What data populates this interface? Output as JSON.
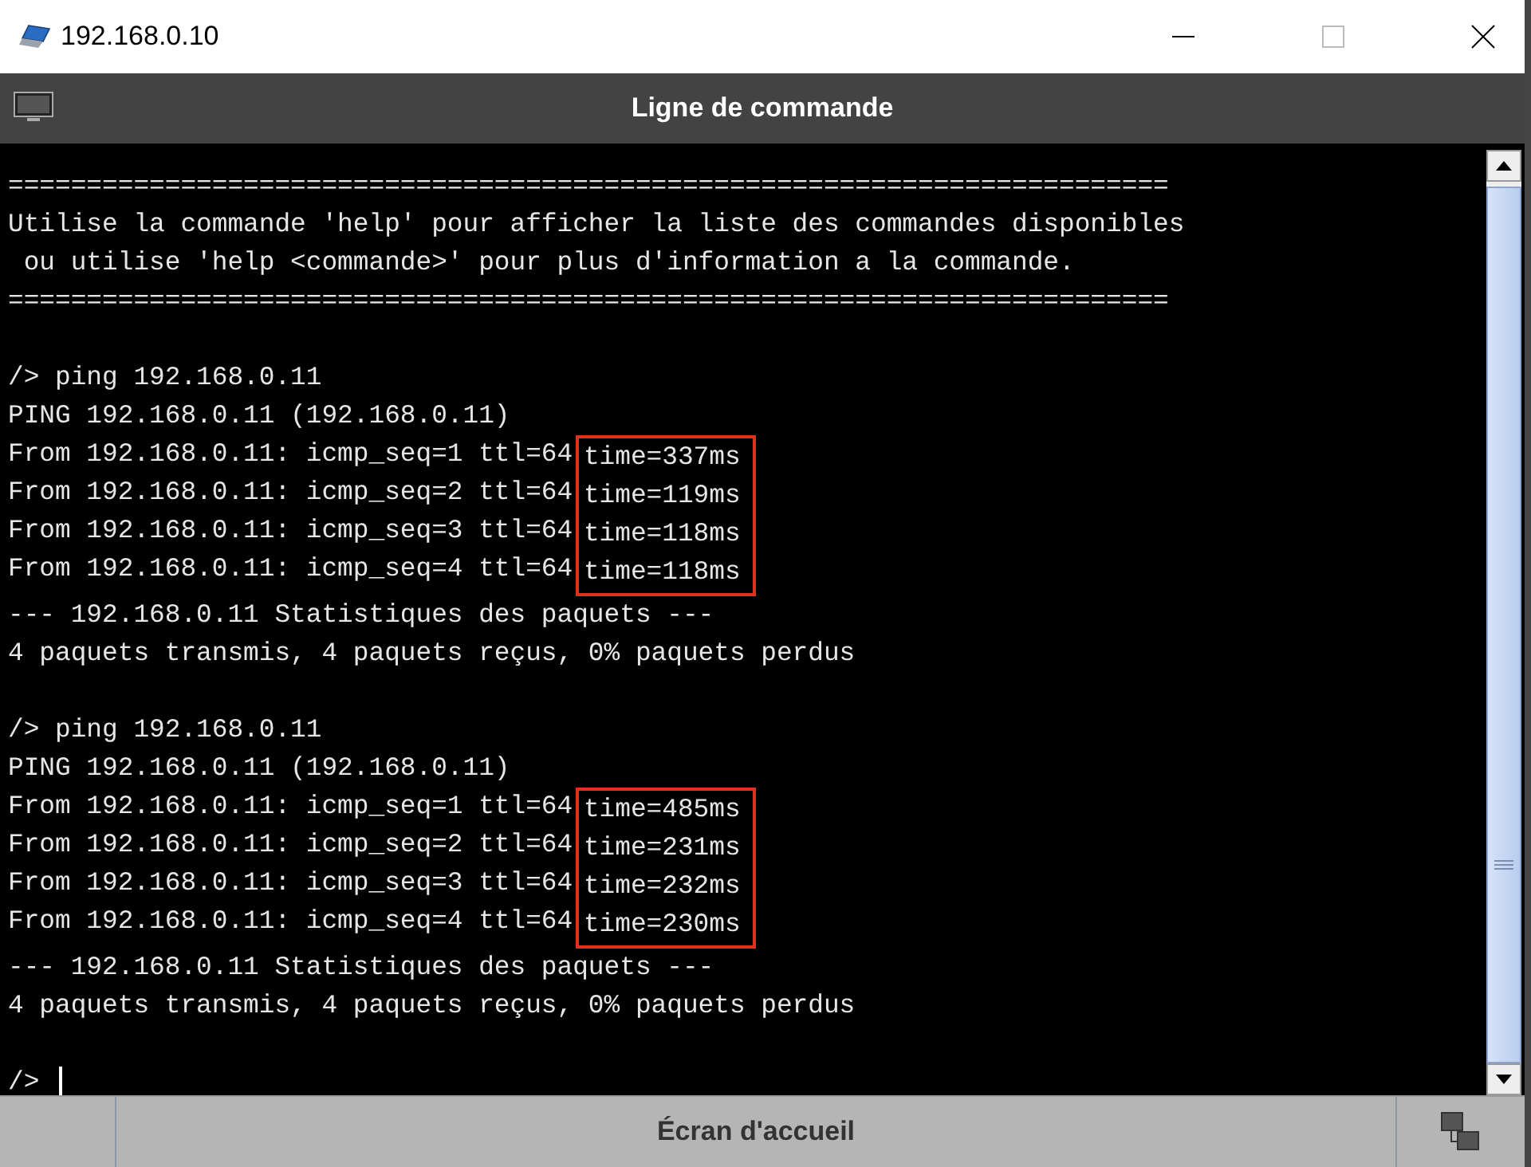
{
  "window": {
    "title": "192.168.0.10"
  },
  "header": {
    "title": "Ligne de commande"
  },
  "terminal": {
    "lines": [
      {
        "kind": "text",
        "text": "=========================================================================="
      },
      {
        "kind": "text",
        "text": "Utilise la commande 'help' pour afficher la liste des commandes disponibles"
      },
      {
        "kind": "text",
        "text": " ou utilise 'help <commande>' pour plus d'information a la commande."
      },
      {
        "kind": "text",
        "text": "=========================================================================="
      },
      {
        "kind": "blank"
      },
      {
        "kind": "text",
        "text": "/> ping 192.168.0.11"
      },
      {
        "kind": "text",
        "text": "PING 192.168.0.11 (192.168.0.11)"
      },
      {
        "kind": "replies",
        "items": [
          {
            "prefix": "From 192.168.0.11: icmp_seq=1 ttl=64",
            "time": "time=337ms"
          },
          {
            "prefix": "From 192.168.0.11: icmp_seq=2 ttl=64",
            "time": "time=119ms"
          },
          {
            "prefix": "From 192.168.0.11: icmp_seq=3 ttl=64",
            "time": "time=118ms"
          },
          {
            "prefix": "From 192.168.0.11: icmp_seq=4 ttl=64",
            "time": "time=118ms"
          }
        ]
      },
      {
        "kind": "text",
        "text": "--- 192.168.0.11 Statistiques des paquets ---"
      },
      {
        "kind": "text",
        "text": "4 paquets transmis, 4 paquets reçus, 0% paquets perdus"
      },
      {
        "kind": "blank"
      },
      {
        "kind": "text",
        "text": "/> ping 192.168.0.11"
      },
      {
        "kind": "text",
        "text": "PING 192.168.0.11 (192.168.0.11)"
      },
      {
        "kind": "replies",
        "items": [
          {
            "prefix": "From 192.168.0.11: icmp_seq=1 ttl=64",
            "time": "time=485ms"
          },
          {
            "prefix": "From 192.168.0.11: icmp_seq=2 ttl=64",
            "time": "time=231ms"
          },
          {
            "prefix": "From 192.168.0.11: icmp_seq=3 ttl=64",
            "time": "time=232ms"
          },
          {
            "prefix": "From 192.168.0.11: icmp_seq=4 ttl=64",
            "time": "time=230ms"
          }
        ]
      },
      {
        "kind": "text",
        "text": "--- 192.168.0.11 Statistiques des paquets ---"
      },
      {
        "kind": "text",
        "text": "4 paquets transmis, 4 paquets reçus, 0% paquets perdus"
      },
      {
        "kind": "blank"
      },
      {
        "kind": "prompt",
        "text": "/>"
      }
    ]
  },
  "footer": {
    "button": "Écran d'accueil"
  }
}
